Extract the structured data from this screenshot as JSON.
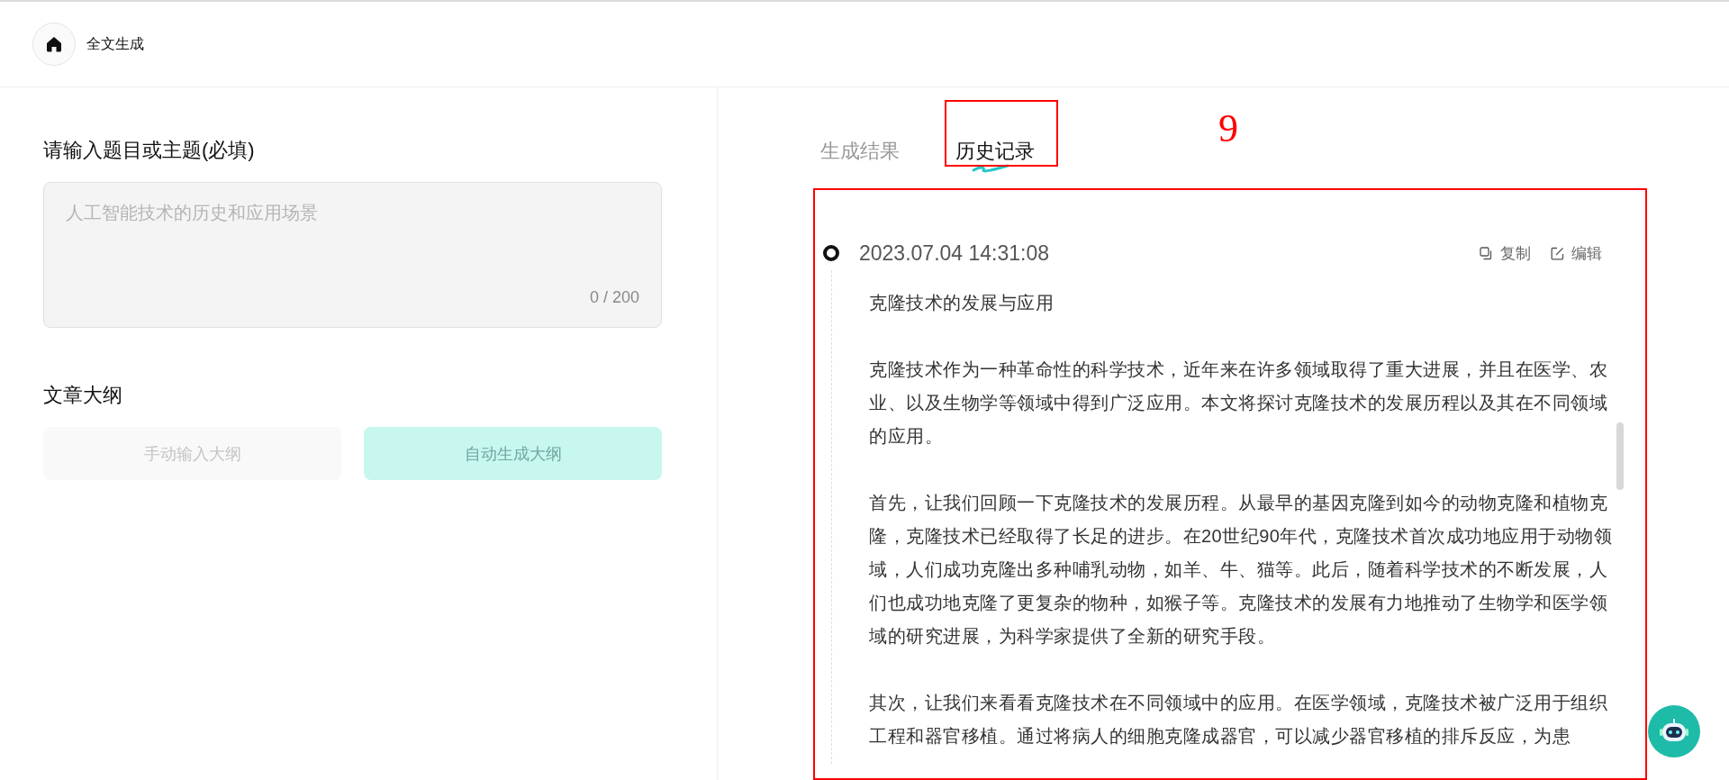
{
  "header": {
    "title": "全文生成"
  },
  "topic": {
    "label": "请输入题目或主题(必填)",
    "placeholder": "人工智能技术的历史和应用场景",
    "counter": "0 / 200"
  },
  "outline": {
    "label": "文章大纲",
    "buttons": [
      {
        "label": "手动输入大纲",
        "kind": "plain"
      },
      {
        "label": "自动生成大纲",
        "kind": "primary"
      }
    ]
  },
  "tabs": [
    {
      "label": "生成结果",
      "selected": false
    },
    {
      "label": "历史记录",
      "selected": true
    }
  ],
  "annotation": {
    "label": "9"
  },
  "history": [
    {
      "time": "2023.07.04 14:31:08",
      "actions": [
        {
          "label": "复制",
          "kind": "copy"
        },
        {
          "label": "编辑",
          "kind": "edit"
        }
      ],
      "paragraphs": [
        "克隆技术的发展与应用",
        "克隆技术作为一种革命性的科学技术，近年来在许多领域取得了重大进展，并且在医学、农业、以及生物学等领域中得到广泛应用。本文将探讨克隆技术的发展历程以及其在不同领域的应用。",
        "首先，让我们回顾一下克隆技术的发展历程。从最早的基因克隆到如今的动物克隆和植物克隆，克隆技术已经取得了长足的进步。在20世纪90年代，克隆技术首次成功地应用于动物领域，人们成功克隆出多种哺乳动物，如羊、牛、猫等。此后，随着科学技术的不断发展，人们也成功地克隆了更复杂的物种，如猴子等。克隆技术的发展有力地推动了生物学和医学领域的研究进展，为科学家提供了全新的研究手段。",
        "其次，让我们来看看克隆技术在不同领域中的应用。在医学领域，克隆技术被广泛用于组织工程和器官移植。通过将病人的细胞克隆成器官，可以减少器官移植的排斥反应，为患"
      ]
    }
  ]
}
